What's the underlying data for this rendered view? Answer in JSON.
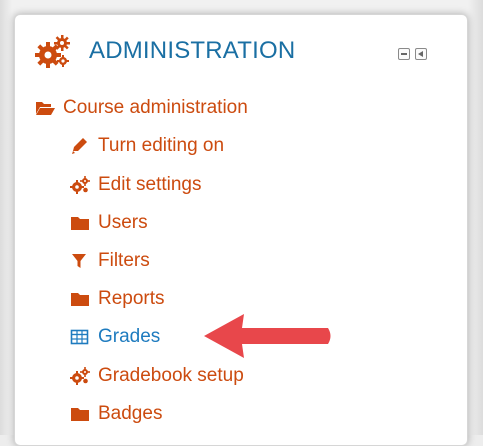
{
  "block": {
    "title": "ADMINISTRATION",
    "course_admin_label": "Course administration",
    "items": [
      {
        "label": "Turn editing on",
        "icon": "pencil-icon"
      },
      {
        "label": "Edit settings",
        "icon": "gears-icon"
      },
      {
        "label": "Users",
        "icon": "folder-icon"
      },
      {
        "label": "Filters",
        "icon": "filter-icon"
      },
      {
        "label": "Reports",
        "icon": "folder-icon"
      },
      {
        "label": "Grades",
        "icon": "table-icon"
      },
      {
        "label": "Gradebook setup",
        "icon": "gears-icon"
      },
      {
        "label": "Badges",
        "icon": "folder-icon"
      }
    ]
  },
  "colors": {
    "title": "#1a6fa3",
    "link": "#cc4b0f",
    "highlighted_link": "#1e7bbf",
    "arrow": "#e8474b"
  }
}
